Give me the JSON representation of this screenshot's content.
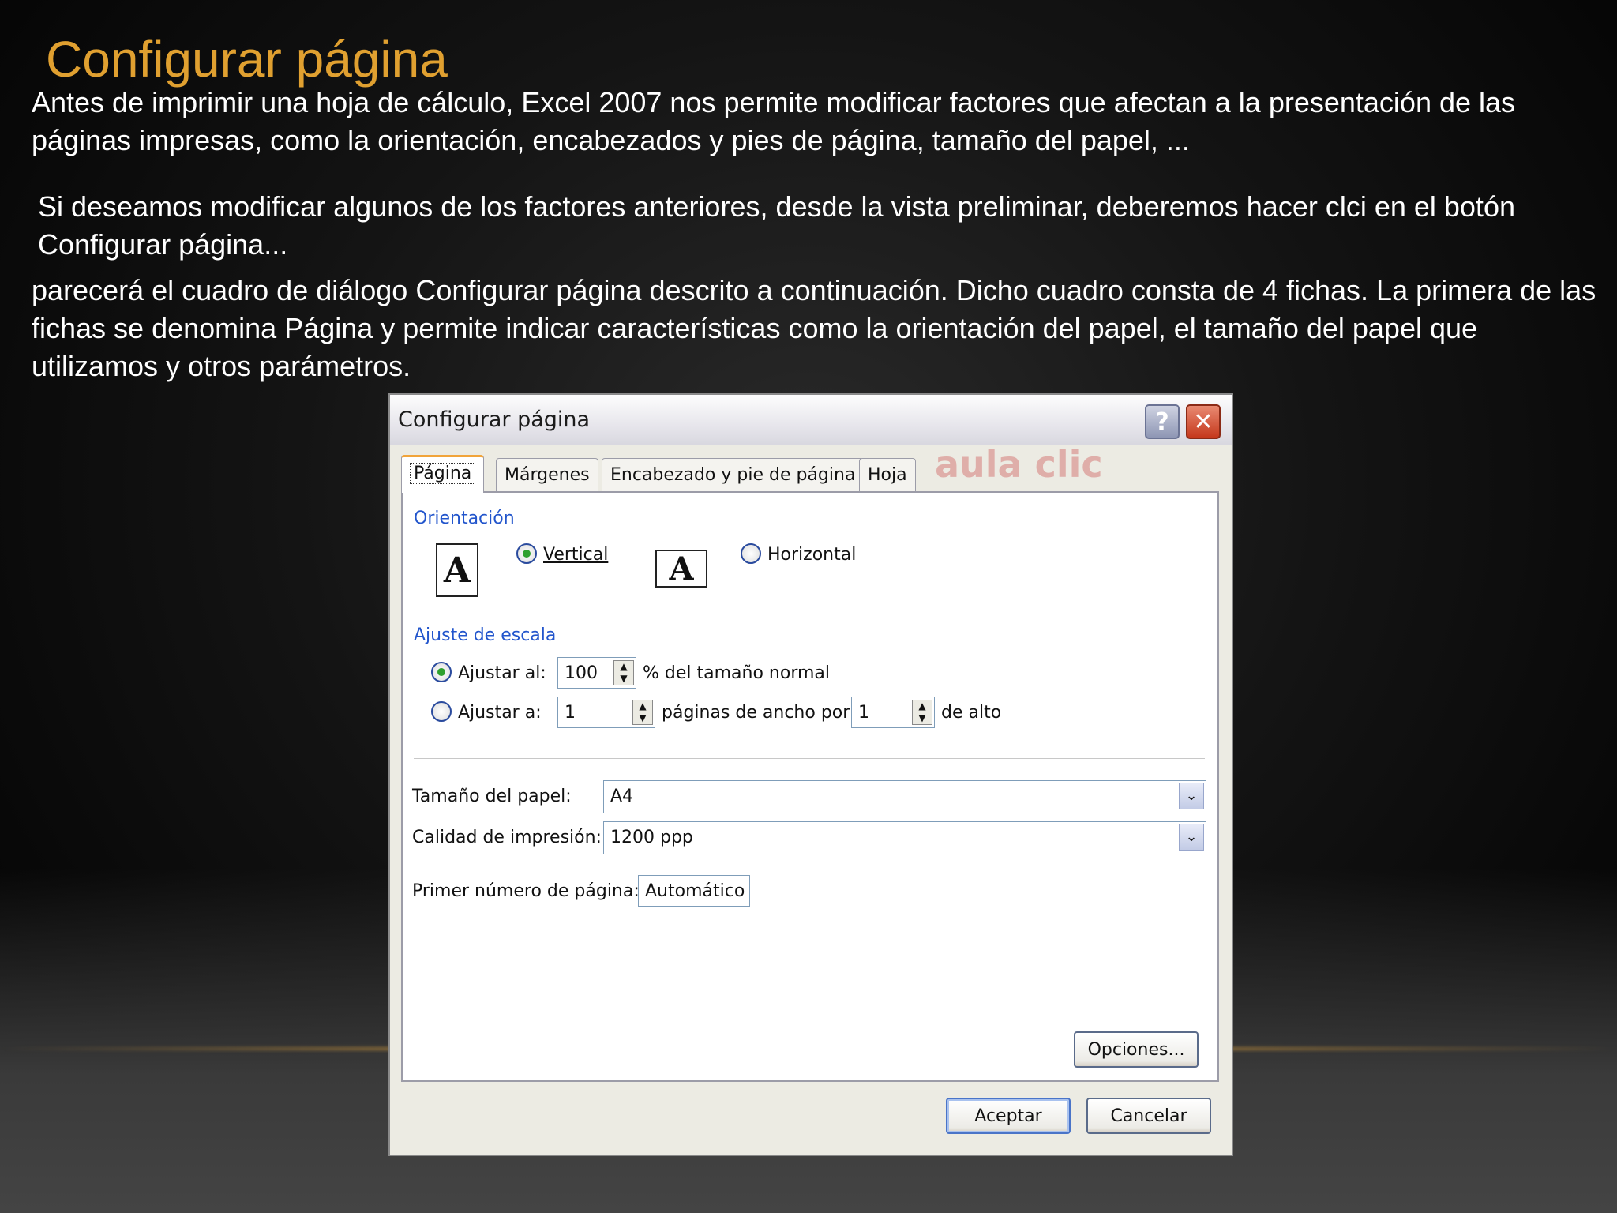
{
  "slide": {
    "title": "Configurar página",
    "paragraph1": "Antes de imprimir una hoja de cálculo, Excel 2007 nos permite modificar factores que afectan a la presentación de las páginas impresas, como la orientación, encabezados y pies de página, tamaño del papel, ...",
    "paragraph2": "Si deseamos modificar algunos de los factores anteriores, desde la vista preliminar, deberemos hacer clci en el botón Configurar página...",
    "paragraph3": "parecerá el cuadro de diálogo Configurar página descrito a continuación. Dicho cuadro consta de 4 fichas. La primera de las fichas se denomina Página y permite indicar características como la orientación del papel, el tamaño del papel que utilizamos y otros parámetros."
  },
  "dialog": {
    "title": "Configurar página",
    "help_label": "?",
    "close_label": "✕",
    "watermark": "aula clic",
    "tabs": [
      {
        "label": "Página"
      },
      {
        "label": "Márgenes"
      },
      {
        "label": "Encabezado y pie de página"
      },
      {
        "label": "Hoja"
      }
    ],
    "orientation": {
      "group_label": "Orientación",
      "vertical_label": "Vertical",
      "horizontal_label": "Horizontal",
      "selected": "vertical",
      "icon_glyph": "A"
    },
    "scaling": {
      "group_label": "Ajuste de escala",
      "adjust_to_label": "Ajustar al:",
      "adjust_to_value": "100",
      "adjust_to_suffix": "% del tamaño normal",
      "fit_to_label": "Ajustar a:",
      "fit_wide_value": "1",
      "fit_wide_suffix": "páginas de ancho por",
      "fit_tall_value": "1",
      "fit_tall_suffix": "de alto",
      "selected": "adjust_to"
    },
    "paper_size": {
      "label": "Tamaño del papel:",
      "value": "A4"
    },
    "print_quality": {
      "label": "Calidad de impresión:",
      "value": "1200 ppp"
    },
    "first_page_number": {
      "label": "Primer número de página:",
      "value": "Automático"
    },
    "options_label": "Opciones...",
    "ok_label": "Aceptar",
    "cancel_label": "Cancelar"
  }
}
